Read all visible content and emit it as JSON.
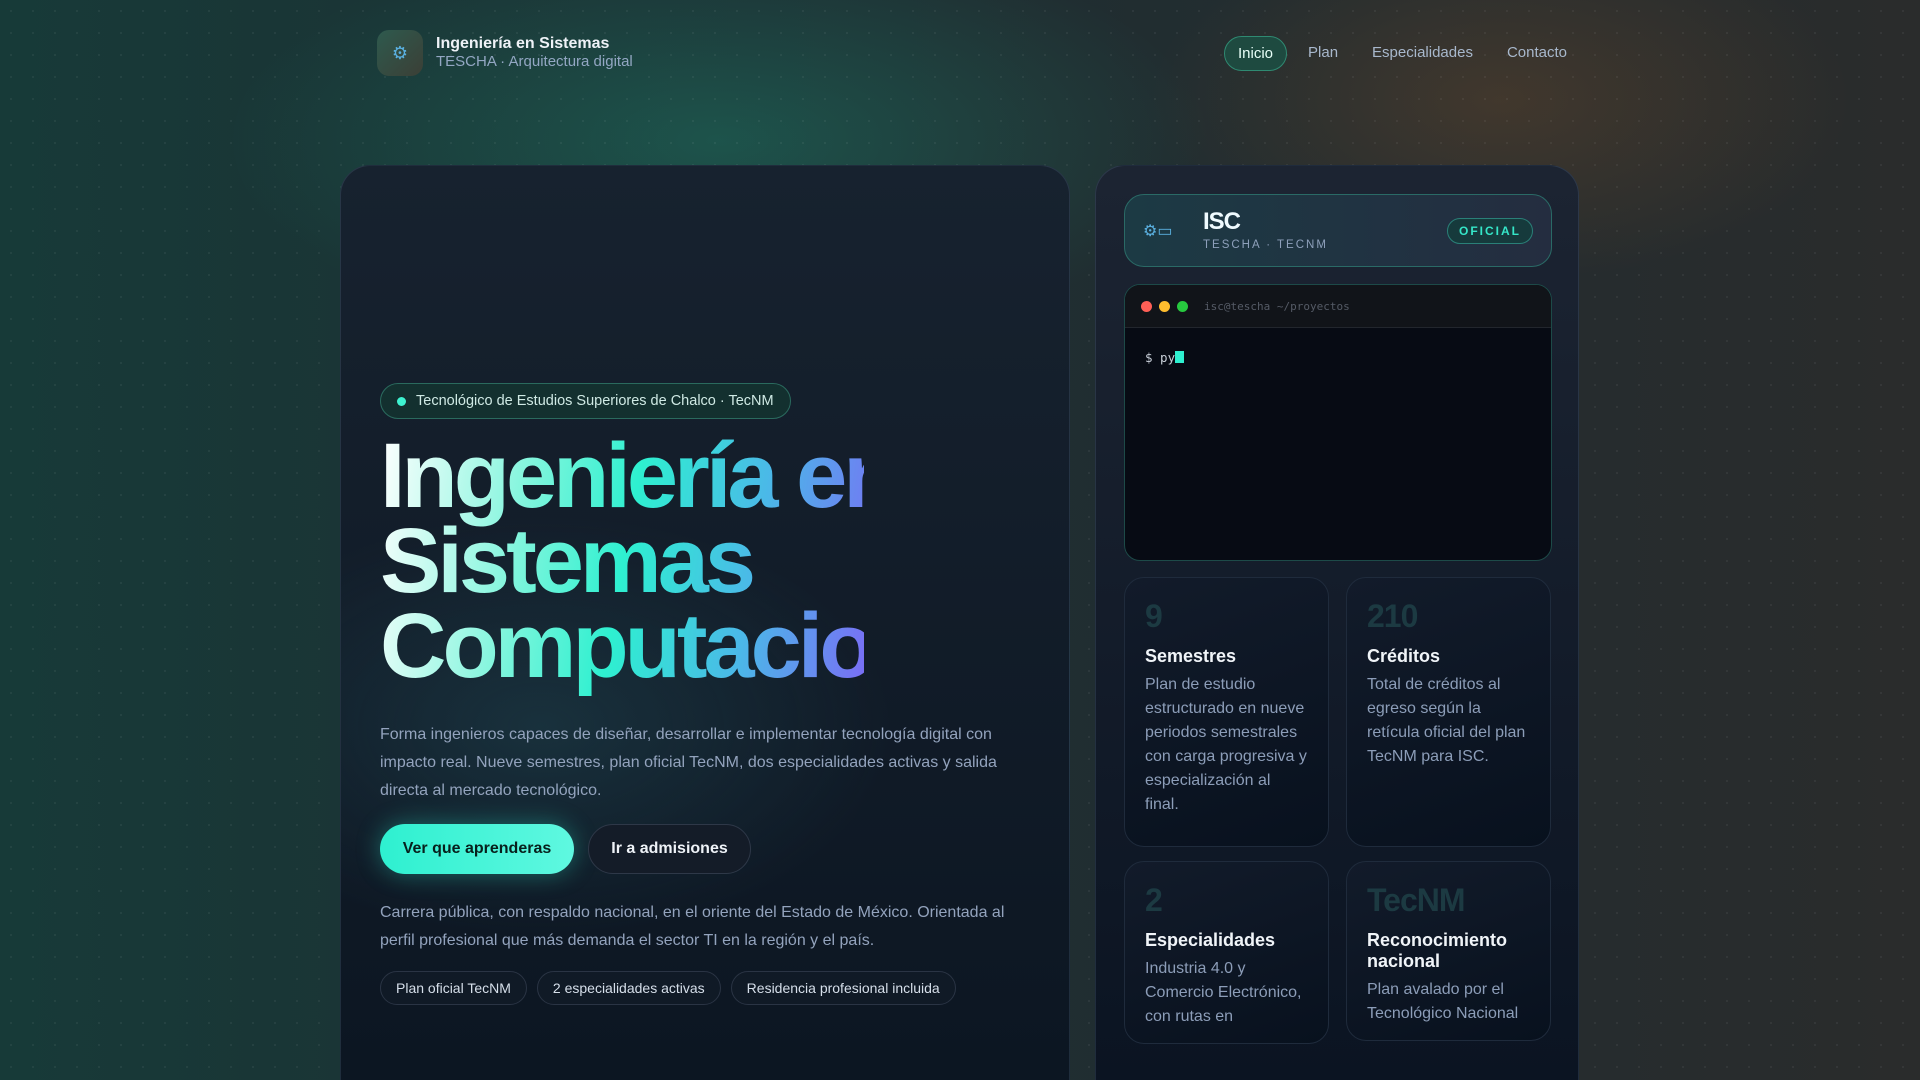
{
  "nav": {
    "title": "Ingeniería en Sistemas",
    "subtitle": "TESCHA · Arquitectura digital",
    "links": [
      "Inicio",
      "Plan",
      "Especialidades",
      "Contacto"
    ]
  },
  "hero": {
    "badge": "Tecnológico de Estudios Superiores de Chalco · TecNM",
    "headline": [
      "Ingeniería en",
      "Sistemas",
      "Computacionales"
    ],
    "lead": "Forma ingenieros capaces de diseñar, desarrollar e implementar tecnología digital con impacto real. Nueve semestres, plan oficial TecNM, dos especialidades activas y salida directa al mercado tecnológico.",
    "primary": "Ver que aprenderas",
    "secondary": "Ir a admisiones",
    "note": "Carrera pública, con respaldo nacional, en el oriente del Estado de México. Orientada al perfil profesional que más demanda el sector TI en la región y el país.",
    "chips": [
      "Plan oficial TecNM",
      "2 especialidades activas",
      "Residencia profesional incluida"
    ]
  },
  "card": {
    "name": "ISC",
    "sub": "TESCHA · TECNM",
    "badge": "OFICIAL"
  },
  "terminal": {
    "path": "isc@tescha ~/proyectos",
    "prompt": "$ py"
  },
  "stats": [
    {
      "n": "9",
      "l": "Semestres",
      "d": "Plan de estudio estructurado en nueve periodos semestrales con carga progresiva y especialización al final."
    },
    {
      "n": "210",
      "l": "Créditos",
      "d": "Total de créditos al egreso según la retícula oficial del plan TecNM para ISC."
    },
    {
      "n": "2",
      "l": "Especialidades",
      "d": "Industria 4.0 y Comercio Electrónico, con rutas en"
    },
    {
      "n": "TecNM",
      "l": "Reconocimiento nacional",
      "d": "Plan avalado por el Tecnológico Nacional"
    }
  ]
}
